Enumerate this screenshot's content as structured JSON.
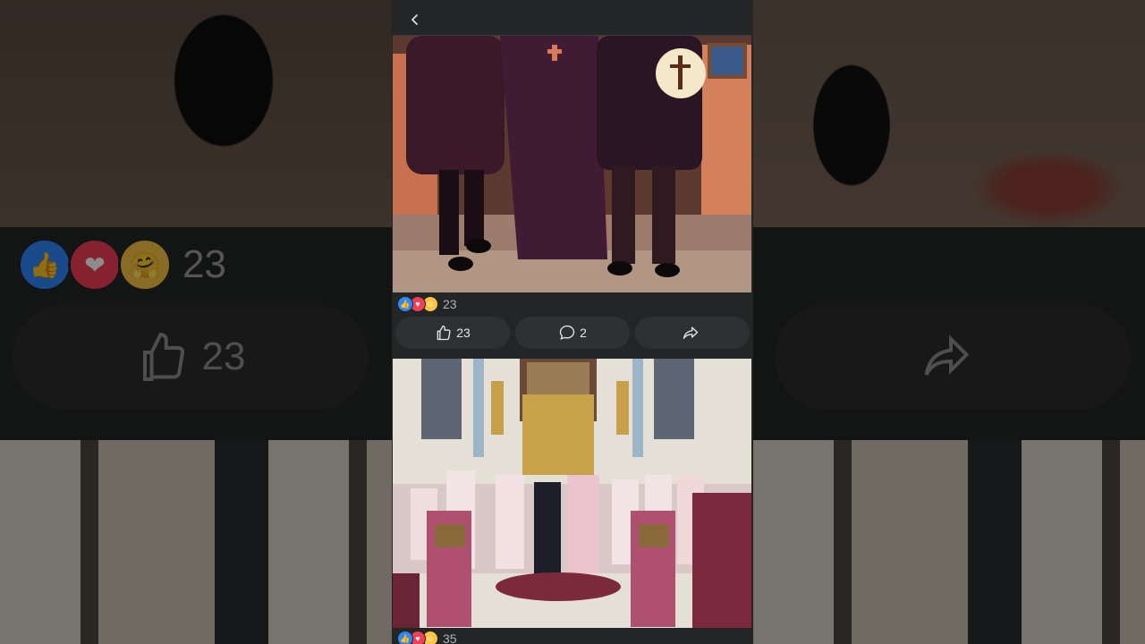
{
  "post": {
    "reactions": {
      "types": [
        "like",
        "love",
        "care"
      ],
      "count": "23"
    },
    "like_count": "23",
    "comment_count": "2",
    "share_label": ""
  },
  "next_post": {
    "reactions": {
      "types": [
        "like",
        "love",
        "care"
      ],
      "count": "35"
    }
  },
  "colors": {
    "like": "#2d88ff",
    "love": "#f33e58",
    "care": "#f7c444",
    "surface": "#242526",
    "pill": "#2e3033",
    "text": "#e4e6eb",
    "muted": "#b0b3b8"
  },
  "icons": {
    "back": "chevron-left-icon",
    "like": "thumbs-up-icon",
    "comment": "comment-bubble-icon",
    "share": "share-arrow-icon"
  }
}
